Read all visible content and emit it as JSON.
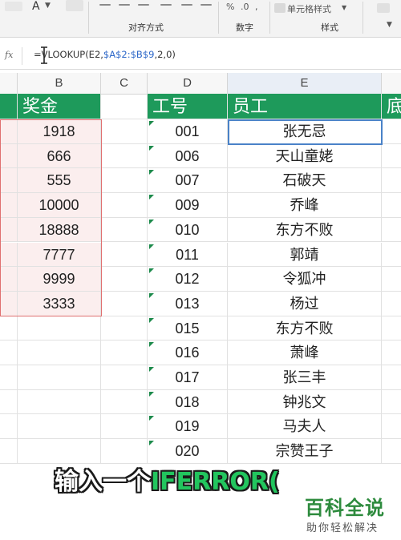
{
  "ribbon": {
    "group_labels": [
      "对齐方式",
      "数字",
      "样式"
    ],
    "cell_style_label": "单元格样式",
    "font_color_glyph": "A"
  },
  "formula_bar": {
    "fx_label": "fx",
    "formula_prefix": "=VLOOKUP(E2,",
    "ref1": "$A$2:$B$9",
    "formula_suffix": ",2,0)"
  },
  "columns": [
    "B",
    "C",
    "D",
    "E"
  ],
  "sheet": {
    "bonus_header": "奖金",
    "bonus_values": [
      "1918",
      "666",
      "555",
      "10000",
      "18888",
      "7777",
      "9999",
      "3333"
    ],
    "id_header": "工号",
    "name_header": "员工",
    "extra_header": "底",
    "ids": [
      "001",
      "006",
      "007",
      "009",
      "010",
      "011",
      "012",
      "013",
      "015",
      "016",
      "017",
      "018",
      "019",
      "020"
    ],
    "names": [
      "张无忌",
      "天山童姥",
      "石破天",
      "乔峰",
      "东方不败",
      "郭靖",
      "令狐冲",
      "杨过",
      "东方不败",
      "萧峰",
      "张三丰",
      "钟兆文",
      "马夫人",
      "宗赞王子"
    ]
  },
  "caption": {
    "prefix": "输入一个",
    "highlight": "IFERROR("
  },
  "watermark": {
    "title": "百科全说",
    "subtitle": "助你轻松解决"
  },
  "colors": {
    "header_green": "#1e9a5b",
    "caption_green": "#22c55e",
    "selection_blue": "#4a82c8"
  }
}
